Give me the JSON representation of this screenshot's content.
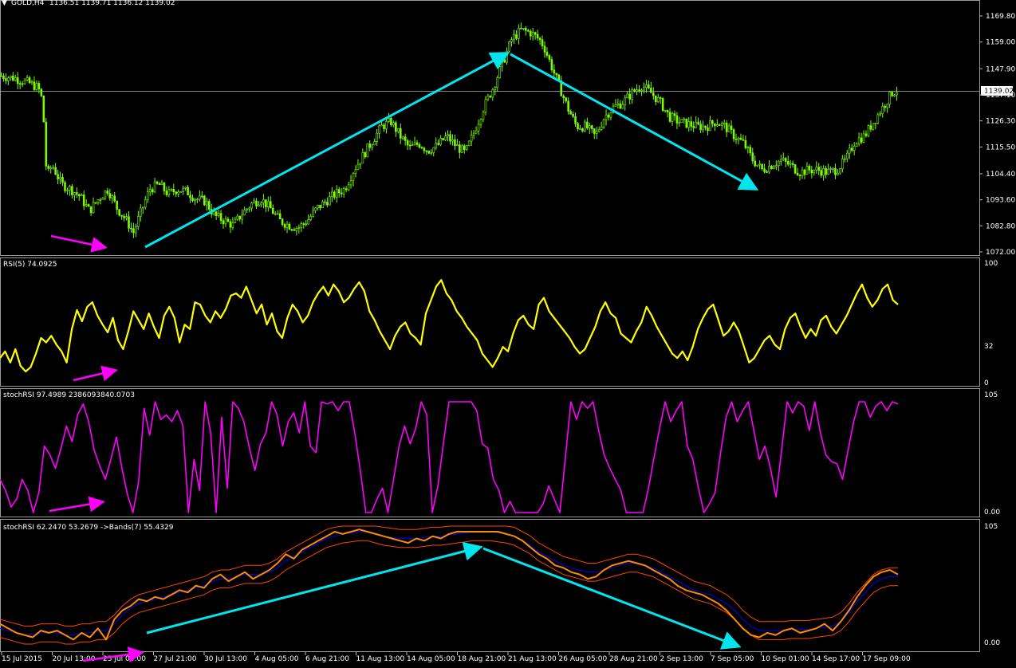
{
  "header": {
    "symbol": "GOLD,H4",
    "ohlc": "1136.51 1139.71 1136.12 1139.02"
  },
  "colors": {
    "background": "#000000",
    "grid": "#ffffff",
    "bull": "#7cfc00",
    "bear": "#7cfc00",
    "rsi": "#ffff00",
    "stoch": "#ff00ff",
    "stoch_main": "#ff8c00",
    "bands": "#ff4500",
    "bands_mid": "#0000ff",
    "trend": "#00e5ee",
    "arrow_magenta": "#ff00ff"
  },
  "chart_data": [
    {
      "type": "candlestick",
      "pane": "price",
      "title": "GOLD,H4",
      "ylim": [
        1072.0,
        1169.8
      ],
      "yticks": [
        "1169.80",
        "1159.00",
        "1147.90",
        "1137.10",
        "1126.30",
        "1115.50",
        "1104.40",
        "1093.60",
        "1082.80",
        "1072.00"
      ],
      "current_price": "1139.02",
      "path": [
        [
          0,
          1145
        ],
        [
          6,
          1144
        ],
        [
          12,
          1142
        ],
        [
          16,
          1140
        ],
        [
          18,
          1134
        ],
        [
          19,
          1110
        ],
        [
          20,
          1104
        ],
        [
          22,
          1108
        ],
        [
          26,
          1100
        ],
        [
          30,
          1098
        ],
        [
          34,
          1095
        ],
        [
          38,
          1089
        ],
        [
          42,
          1094
        ],
        [
          46,
          1098
        ],
        [
          50,
          1090
        ],
        [
          54,
          1085
        ],
        [
          57,
          1080
        ],
        [
          60,
          1088
        ],
        [
          64,
          1098
        ],
        [
          68,
          1100
        ],
        [
          72,
          1096
        ],
        [
          76,
          1098
        ],
        [
          80,
          1097
        ],
        [
          84,
          1094
        ],
        [
          88,
          1093
        ],
        [
          92,
          1087
        ],
        [
          96,
          1085
        ],
        [
          100,
          1083
        ],
        [
          104,
          1088
        ],
        [
          108,
          1092
        ],
        [
          112,
          1094
        ],
        [
          116,
          1090
        ],
        [
          120,
          1085
        ],
        [
          124,
          1083
        ],
        [
          128,
          1082
        ],
        [
          132,
          1085
        ],
        [
          136,
          1090
        ],
        [
          140,
          1093
        ],
        [
          144,
          1096
        ],
        [
          148,
          1098
        ],
        [
          152,
          1106
        ],
        [
          156,
          1112
        ],
        [
          160,
          1118
        ],
        [
          164,
          1124
        ],
        [
          168,
          1126
        ],
        [
          172,
          1120
        ],
        [
          176,
          1115
        ],
        [
          180,
          1117
        ],
        [
          184,
          1114
        ],
        [
          188,
          1116
        ],
        [
          192,
          1120
        ],
        [
          196,
          1116
        ],
        [
          200,
          1113
        ],
        [
          204,
          1122
        ],
        [
          208,
          1132
        ],
        [
          212,
          1140
        ],
        [
          216,
          1150
        ],
        [
          220,
          1160
        ],
        [
          224,
          1164
        ],
        [
          228,
          1163
        ],
        [
          232,
          1160
        ],
        [
          234,
          1157
        ],
        [
          236,
          1152
        ],
        [
          240,
          1142
        ],
        [
          244,
          1132
        ],
        [
          248,
          1124
        ],
        [
          252,
          1124
        ],
        [
          256,
          1120
        ],
        [
          260,
          1128
        ],
        [
          264,
          1132
        ],
        [
          268,
          1134
        ],
        [
          272,
          1138
        ],
        [
          276,
          1141
        ],
        [
          280,
          1138
        ],
        [
          284,
          1134
        ],
        [
          288,
          1128
        ],
        [
          292,
          1126
        ],
        [
          296,
          1125
        ],
        [
          300,
          1124
        ],
        [
          304,
          1124
        ],
        [
          308,
          1126
        ],
        [
          312,
          1124
        ],
        [
          316,
          1120
        ],
        [
          320,
          1117
        ],
        [
          324,
          1110
        ],
        [
          328,
          1106
        ],
        [
          332,
          1108
        ],
        [
          336,
          1110
        ],
        [
          340,
          1108
        ],
        [
          344,
          1105
        ],
        [
          348,
          1106
        ],
        [
          352,
          1106
        ],
        [
          356,
          1105
        ],
        [
          360,
          1106
        ],
        [
          364,
          1110
        ],
        [
          368,
          1118
        ],
        [
          372,
          1120
        ],
        [
          376,
          1126
        ],
        [
          380,
          1132
        ],
        [
          384,
          1138
        ],
        [
          386,
          1139
        ]
      ]
    },
    {
      "type": "line",
      "pane": "rsi",
      "title": "RSI(5) 74.0925",
      "ylim": [
        0,
        100
      ],
      "yticks": [
        "100",
        "32",
        "0"
      ],
      "series": [
        {
          "name": "RSI(5)",
          "values": [
            22,
            28,
            18,
            30,
            15,
            10,
            14,
            26,
            40,
            36,
            42,
            34,
            28,
            18,
            48,
            65,
            55,
            68,
            72,
            60,
            52,
            45,
            58,
            38,
            30,
            46,
            64,
            56,
            48,
            62,
            50,
            40,
            60,
            68,
            58,
            36,
            52,
            48,
            72,
            70,
            60,
            54,
            64,
            58,
            66,
            78,
            80,
            76,
            86,
            74,
            62,
            70,
            52,
            62,
            46,
            40,
            58,
            70,
            64,
            54,
            60,
            72,
            80,
            86,
            78,
            88,
            82,
            72,
            76,
            84,
            90,
            82,
            64,
            56,
            46,
            38,
            30,
            42,
            50,
            54,
            44,
            40,
            34,
            62,
            74,
            86,
            92,
            80,
            74,
            64,
            58,
            50,
            44,
            38,
            26,
            20,
            14,
            22,
            32,
            28,
            44,
            56,
            60,
            52,
            48,
            70,
            76,
            64,
            58,
            52,
            46,
            40,
            32,
            26,
            30,
            40,
            50,
            64,
            72,
            62,
            58,
            44,
            40,
            36,
            46,
            54,
            68,
            60,
            50,
            42,
            34,
            26,
            22,
            28,
            20,
            32,
            48,
            58,
            66,
            70,
            56,
            42,
            46,
            54,
            46,
            32,
            18,
            22,
            30,
            38,
            42,
            34,
            30,
            48,
            58,
            62,
            50,
            40,
            48,
            42,
            56,
            60,
            50,
            44,
            52,
            60,
            70,
            80,
            88,
            76,
            68,
            74,
            84,
            88,
            74,
            70
          ]
        }
      ]
    },
    {
      "type": "line",
      "pane": "stochrsi",
      "title": "stochRSI 97.4989 2386093840.0703",
      "ylim": [
        0,
        105
      ],
      "yticks": [
        "105",
        "0.00"
      ],
      "series": [
        {
          "name": "stochRSI",
          "values": [
            30,
            20,
            5,
            12,
            30,
            20,
            0,
            18,
            60,
            52,
            40,
            58,
            78,
            64,
            88,
            98,
            82,
            56,
            42,
            30,
            48,
            68,
            40,
            16,
            0,
            28,
            94,
            70,
            100,
            84,
            88,
            82,
            92,
            78,
            0,
            48,
            20,
            100,
            72,
            0,
            86,
            22,
            100,
            94,
            82,
            58,
            38,
            62,
            72,
            100,
            88,
            60,
            82,
            90,
            72,
            100,
            60,
            54,
            100,
            98,
            100,
            92,
            100,
            100,
            72,
            38,
            0,
            0,
            12,
            22,
            0,
            30,
            60,
            78,
            62,
            76,
            100,
            88,
            0,
            24,
            62,
            100,
            100,
            100,
            100,
            100,
            92,
            62,
            58,
            30,
            20,
            0,
            10,
            0,
            0,
            0,
            0,
            0,
            8,
            24,
            12,
            0,
            50,
            100,
            84,
            100,
            94,
            100,
            74,
            52,
            40,
            30,
            20,
            0,
            0,
            0,
            0,
            22,
            50,
            76,
            100,
            82,
            92,
            100,
            60,
            48,
            22,
            0,
            8,
            18,
            54,
            86,
            100,
            82,
            92,
            100,
            74,
            48,
            60,
            40,
            14,
            56,
            100,
            90,
            100,
            96,
            74,
            100,
            72,
            52,
            46,
            44,
            30,
            56,
            82,
            100,
            100,
            86,
            96,
            100,
            92,
            100,
            98
          ]
        }
      ]
    },
    {
      "type": "line",
      "pane": "stochrsi_bands",
      "title": "stochRSI 62.2470 53.2679 ->Bands(7) 55.4329",
      "ylim": [
        0,
        105
      ],
      "yticks": [
        "105",
        "0.00"
      ],
      "series": [
        {
          "name": "stochRSI",
          "values": [
            18,
            14,
            10,
            8,
            6,
            12,
            10,
            12,
            8,
            4,
            10,
            6,
            14,
            4,
            22,
            30,
            34,
            40,
            38,
            42,
            40,
            44,
            48,
            46,
            52,
            50,
            58,
            62,
            56,
            60,
            64,
            58,
            62,
            66,
            72,
            80,
            76,
            84,
            88,
            92,
            96,
            100,
            98,
            100,
            102,
            100,
            98,
            96,
            94,
            92,
            90,
            94,
            92,
            96,
            94,
            98,
            100,
            100,
            100,
            100,
            100,
            100,
            98,
            96,
            92,
            86,
            80,
            76,
            70,
            68,
            64,
            62,
            58,
            60,
            66,
            70,
            72,
            74,
            72,
            70,
            66,
            62,
            58,
            52,
            48,
            46,
            44,
            40,
            36,
            30,
            22,
            14,
            8,
            6,
            10,
            8,
            12,
            14,
            10,
            12,
            14,
            18,
            12,
            20,
            30,
            42,
            52,
            60,
            64,
            66,
            62
          ]
        },
        {
          "name": "Bands",
          "values": [
            14,
            12,
            10,
            8,
            8,
            10,
            10,
            10,
            8,
            8,
            10,
            10,
            12,
            12,
            18,
            26,
            32,
            36,
            38,
            40,
            42,
            44,
            46,
            48,
            50,
            52,
            56,
            58,
            58,
            60,
            62,
            62,
            62,
            64,
            68,
            74,
            78,
            82,
            86,
            90,
            94,
            96,
            98,
            99,
            100,
            100,
            98,
            96,
            95,
            94,
            94,
            94,
            95,
            96,
            96,
            97,
            98,
            99,
            100,
            100,
            100,
            99,
            98,
            96,
            92,
            88,
            82,
            78,
            74,
            70,
            68,
            66,
            64,
            64,
            66,
            68,
            70,
            72,
            72,
            70,
            68,
            64,
            60,
            56,
            52,
            48,
            46,
            44,
            40,
            36,
            30,
            22,
            16,
            12,
            12,
            12,
            12,
            13,
            13,
            13,
            14,
            15,
            16,
            20,
            28,
            38,
            46,
            54,
            58,
            60,
            60
          ]
        }
      ]
    }
  ],
  "time_axis": {
    "labels": [
      "15 Jul 2015",
      "20 Jul 13:00",
      "23 Jul 05:00",
      "27 Jul 21:00",
      "30 Jul 13:00",
      "4 Aug 05:00",
      "6 Aug 21:00",
      "11 Aug 13:00",
      "14 Aug 05:00",
      "18 Aug 21:00",
      "21 Aug 13:00",
      "26 Aug 05:00",
      "28 Aug 21:00",
      "2 Sep 13:00",
      "7 Sep 05:00",
      "10 Sep 01:00",
      "14 Sep 17:00",
      "17 Sep 09:00"
    ]
  }
}
